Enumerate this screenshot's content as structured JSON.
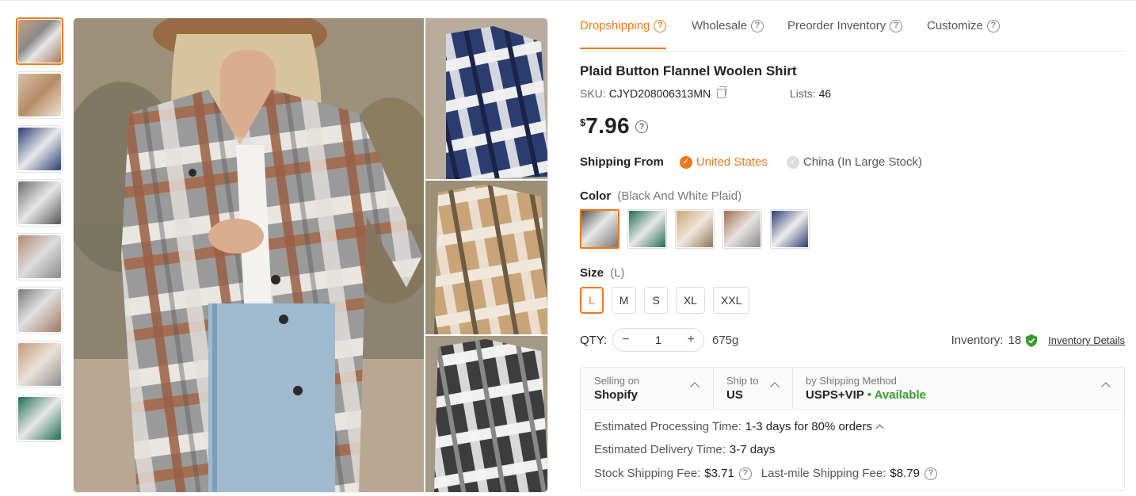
{
  "tabs": [
    {
      "label": "Dropshipping",
      "active": true
    },
    {
      "label": "Wholesale",
      "active": false
    },
    {
      "label": "Preorder Inventory",
      "active": false
    },
    {
      "label": "Customize",
      "active": false
    }
  ],
  "product": {
    "title": "Plaid Button Flannel Woolen Shirt",
    "sku_label": "SKU:",
    "sku": "CJYD208006313MN",
    "lists_label": "Lists:",
    "lists": "46",
    "price_currency": "$",
    "price": "7.96"
  },
  "shipping_from": {
    "label": "Shipping From",
    "options": [
      {
        "label": "United States",
        "selected": true
      },
      {
        "label": "China (In Large Stock)",
        "selected": false
      }
    ]
  },
  "color": {
    "label": "Color",
    "selected_text": "(Black And White Plaid)",
    "swatch_colors": [
      "#8f8f8f",
      "#2f7a62",
      "#b89570",
      "#9f8a80",
      "#3b4a7a"
    ]
  },
  "size": {
    "label": "Size",
    "selected_text": "(L)",
    "options": [
      "L",
      "M",
      "S",
      "XL",
      "XXL"
    ],
    "selected_index": 0
  },
  "qty": {
    "label": "QTY:",
    "minus": "−",
    "plus": "+",
    "value": "1",
    "weight": "675g",
    "inventory_label": "Inventory:",
    "inventory": "18",
    "inventory_link": "Inventory Details"
  },
  "shipping": {
    "selling_on_label": "Selling on",
    "selling_on": "Shopify",
    "ship_to_label": "Ship to",
    "ship_to": "US",
    "method_label": "by Shipping Method",
    "method": "USPS+VIP",
    "availability": "• Available",
    "processing_label": "Estimated Processing Time:",
    "processing": "1-3 days for 80% orders",
    "delivery_label": "Estimated Delivery Time:",
    "delivery": "3-7 days",
    "stock_fee_label": "Stock Shipping Fee:",
    "stock_fee": "$3.71",
    "lastmile_label": "Last-mile Shipping Fee:",
    "lastmile_fee": "$8.79"
  },
  "thumbnails": {
    "colors": [
      "#a8978a",
      "#b79f84",
      "#34477a",
      "#8d8d8d",
      "#a0908a",
      "#928a85",
      "#a5907f",
      "#2d7a5c"
    ],
    "active_index": 0
  },
  "colors": {
    "accent": "#f0781e",
    "available": "#3a9a2f"
  }
}
